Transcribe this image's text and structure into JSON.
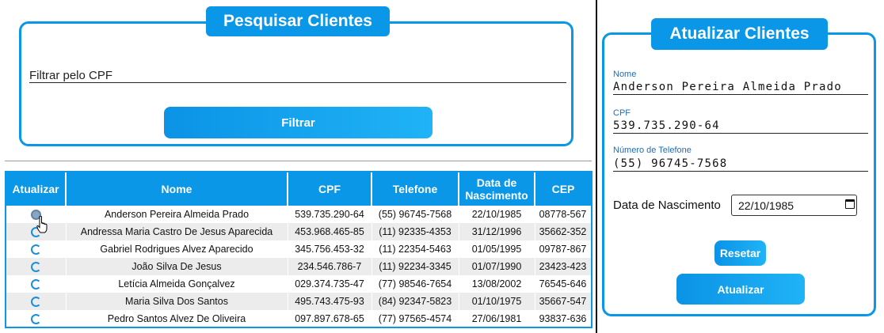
{
  "search": {
    "title": "Pesquisar Clientes",
    "placeholder": "Filtrar pelo CPF",
    "button": "Filtrar"
  },
  "table": {
    "headers": [
      "Atualizar",
      "Nome",
      "CPF",
      "Telefone",
      "Data de Nascimento",
      "CEP"
    ],
    "rows": [
      {
        "nome": "Anderson Pereira Almeida Prado",
        "cpf": "539.735.290-64",
        "telefone": "(55) 96745-7568",
        "nascimento": "22/10/1985",
        "cep": "08778-567"
      },
      {
        "nome": "Andressa Maria Castro De Jesus Aparecida",
        "cpf": "453.968.465-85",
        "telefone": "(11) 92335-4353",
        "nascimento": "31/12/1996",
        "cep": "35662-352"
      },
      {
        "nome": "Gabriel Rodrigues Alvez Aparecido",
        "cpf": "345.756.453-32",
        "telefone": "(11) 22354-5463",
        "nascimento": "01/05/1995",
        "cep": "09787-867"
      },
      {
        "nome": "João Silva De Jesus",
        "cpf": "234.546.786-7",
        "telefone": "(11) 92234-3345",
        "nascimento": "01/07/1990",
        "cep": "23423-423"
      },
      {
        "nome": "Letícia Almeida Gonçalvez",
        "cpf": "029.374.735-47",
        "telefone": "(77) 98546-7654",
        "nascimento": "13/08/2002",
        "cep": "76545-646"
      },
      {
        "nome": "Maria Silva Dos Santos",
        "cpf": "495.743.475-93",
        "telefone": "(84) 92347-5823",
        "nascimento": "01/10/1975",
        "cep": "35667-547"
      },
      {
        "nome": "Pedro Santos Alvez De Oliveira",
        "cpf": "097.897.678-65",
        "telefone": "(77) 97565-4574",
        "nascimento": "27/06/1981",
        "cep": "93837-636"
      }
    ]
  },
  "update": {
    "title": "Atualizar Clientes",
    "nome_label": "Nome",
    "nome_value": "Anderson Pereira Almeida Prado",
    "cpf_label": "CPF",
    "cpf_value": "539.735.290-64",
    "telefone_label": "Número de Telefone",
    "telefone_value": "(55) 96745-7568",
    "nascimento_label": "Data de Nascimento",
    "nascimento_value": "22/10/1985",
    "reset_button": "Resetar",
    "update_button": "Atualizar"
  },
  "colors": {
    "accent": "#0a97e8",
    "row_alt": "#ececec"
  },
  "icons": {
    "row_action": "refresh-icon",
    "date_picker": "calendar-icon"
  }
}
